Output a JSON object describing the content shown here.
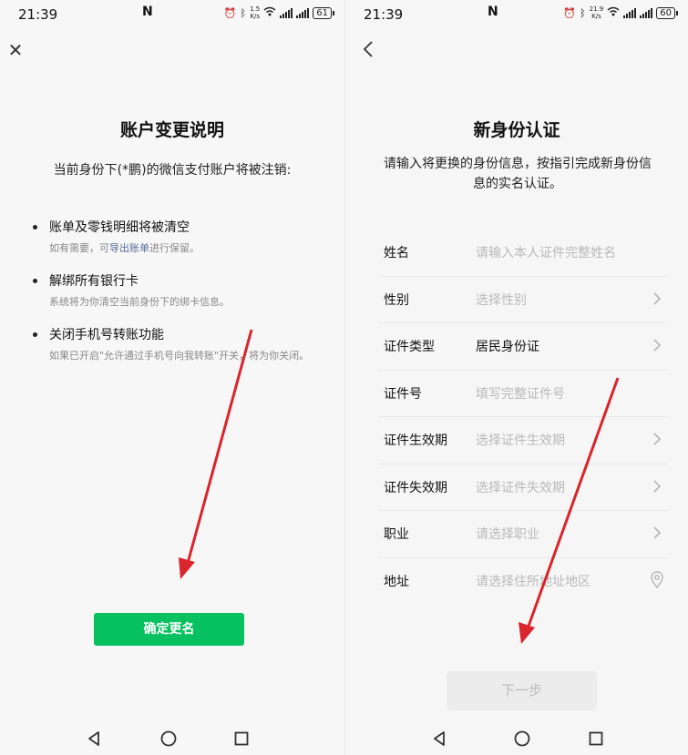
{
  "left": {
    "status": {
      "time": "21:39",
      "nfc": "N",
      "speed_top": "1.5",
      "speed_unit": "K/s",
      "battery": "61"
    },
    "title": "账户变更说明",
    "subtitle": "当前身份下(*鹏)的微信支付账户将被注销:",
    "items": [
      {
        "head": "账单及零钱明细将被清空",
        "desc_before": "如有需要，可",
        "desc_link": "导出账单",
        "desc_after": "进行保留。"
      },
      {
        "head": "解绑所有银行卡",
        "desc": "系统将为你清空当前身份下的绑卡信息。"
      },
      {
        "head": "关闭手机号转账功能",
        "desc": "如果已开启\"允许通过手机号向我转账\"开关，将为你关闭。"
      }
    ],
    "confirm_button": "确定更名"
  },
  "right": {
    "status": {
      "time": "21:39",
      "nfc": "N",
      "speed_top": "21.9",
      "speed_unit": "K/s",
      "battery": "60"
    },
    "title": "新身份认证",
    "subtitle": "请输入将更换的身份信息，按指引完成新身份信息的实名认证。",
    "fields": [
      {
        "label": "姓名",
        "value": "请输入本人证件完整姓名"
      },
      {
        "label": "性别",
        "value": "选择性别"
      },
      {
        "label": "证件类型",
        "value": "居民身份证"
      },
      {
        "label": "证件号",
        "value": "填写完整证件号"
      },
      {
        "label": "证件生效期",
        "value": "选择证件生效期"
      },
      {
        "label": "证件失效期",
        "value": "选择证件失效期"
      },
      {
        "label": "职业",
        "value": "请选择职业"
      },
      {
        "label": "地址",
        "value": "请选择住所地址地区"
      }
    ],
    "next_button": "下一步"
  },
  "icons": {
    "close": "close-icon",
    "back": "back-arrow-icon",
    "chevron": "chevron-right-icon",
    "location": "location-pin-icon",
    "nav_back": "nav-back-triangle-icon",
    "nav_home": "nav-home-circle-icon",
    "nav_recent": "nav-recent-square-icon"
  },
  "colors": {
    "accent": "#07c160",
    "link": "#576b95",
    "annotation": "#d9252b"
  }
}
